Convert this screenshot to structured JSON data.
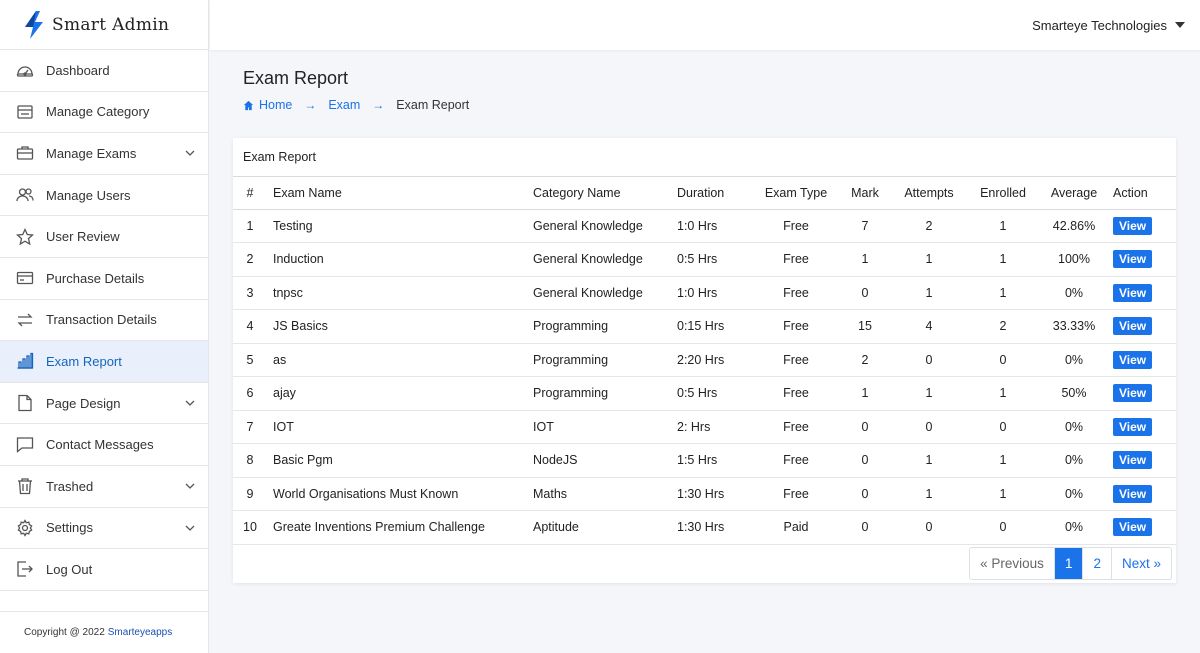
{
  "brand": {
    "name": "Smart Admin"
  },
  "topbar": {
    "org_name": "Smarteye Technologies"
  },
  "sidebar": {
    "items": [
      {
        "label": "Dashboard",
        "icon": "dashboard-icon"
      },
      {
        "label": "Manage Category",
        "icon": "category-icon"
      },
      {
        "label": "Manage Exams",
        "icon": "exams-icon",
        "expandable": true
      },
      {
        "label": "Manage Users",
        "icon": "users-icon"
      },
      {
        "label": "User Review",
        "icon": "star-icon"
      },
      {
        "label": "Purchase Details",
        "icon": "card-icon"
      },
      {
        "label": "Transaction Details",
        "icon": "transfer-icon"
      },
      {
        "label": "Exam Report",
        "icon": "bar-chart-icon",
        "active": true
      },
      {
        "label": "Page Design",
        "icon": "page-icon",
        "expandable": true
      },
      {
        "label": "Contact Messages",
        "icon": "message-icon"
      },
      {
        "label": "Trashed",
        "icon": "trash-icon",
        "expandable": true
      },
      {
        "label": "Settings",
        "icon": "gear-icon",
        "expandable": true
      },
      {
        "label": "Log Out",
        "icon": "logout-icon"
      }
    ],
    "footer": {
      "text": "Copyright @ 2022",
      "link": "Smarteyeapps"
    }
  },
  "page": {
    "title": "Exam Report",
    "breadcrumb": {
      "home": "Home",
      "exam": "Exam",
      "current": "Exam Report"
    }
  },
  "report": {
    "card_title": "Exam Report",
    "columns": [
      "#",
      "Exam Name",
      "Category Name",
      "Duration",
      "Exam Type",
      "Mark",
      "Attempts",
      "Enrolled",
      "Average",
      "Action"
    ],
    "rows": [
      {
        "num": "1",
        "name": "Testing",
        "category": "General Knowledge",
        "duration": "1:0 Hrs",
        "type": "Free",
        "mark": "7",
        "attempts": "2",
        "enrolled": "1",
        "average": "42.86%",
        "action": "View"
      },
      {
        "num": "2",
        "name": "Induction",
        "category": "General Knowledge",
        "duration": "0:5 Hrs",
        "type": "Free",
        "mark": "1",
        "attempts": "1",
        "enrolled": "1",
        "average": "100%",
        "action": "View"
      },
      {
        "num": "3",
        "name": "tnpsc",
        "category": "General Knowledge",
        "duration": "1:0 Hrs",
        "type": "Free",
        "mark": "0",
        "attempts": "1",
        "enrolled": "1",
        "average": "0%",
        "action": "View"
      },
      {
        "num": "4",
        "name": "JS Basics",
        "category": "Programming",
        "duration": "0:15 Hrs",
        "type": "Free",
        "mark": "15",
        "attempts": "4",
        "enrolled": "2",
        "average": "33.33%",
        "action": "View"
      },
      {
        "num": "5",
        "name": "as",
        "category": "Programming",
        "duration": "2:20 Hrs",
        "type": "Free",
        "mark": "2",
        "attempts": "0",
        "enrolled": "0",
        "average": "0%",
        "action": "View"
      },
      {
        "num": "6",
        "name": "ajay",
        "category": "Programming",
        "duration": "0:5 Hrs",
        "type": "Free",
        "mark": "1",
        "attempts": "1",
        "enrolled": "1",
        "average": "50%",
        "action": "View"
      },
      {
        "num": "7",
        "name": "IOT",
        "category": "IOT",
        "duration": "2: Hrs",
        "type": "Free",
        "mark": "0",
        "attempts": "0",
        "enrolled": "0",
        "average": "0%",
        "action": "View"
      },
      {
        "num": "8",
        "name": "Basic Pgm",
        "category": "NodeJS",
        "duration": "1:5 Hrs",
        "type": "Free",
        "mark": "0",
        "attempts": "1",
        "enrolled": "1",
        "average": "0%",
        "action": "View"
      },
      {
        "num": "9",
        "name": "World Organisations Must Known",
        "category": "Maths",
        "duration": "1:30 Hrs",
        "type": "Free",
        "mark": "0",
        "attempts": "1",
        "enrolled": "1",
        "average": "0%",
        "action": "View"
      },
      {
        "num": "10",
        "name": "Greate Inventions Premium Challenge",
        "category": "Aptitude",
        "duration": "1:30 Hrs",
        "type": "Paid",
        "mark": "0",
        "attempts": "0",
        "enrolled": "0",
        "average": "0%",
        "action": "View"
      }
    ]
  },
  "pagination": {
    "previous": "« Previous",
    "pages": [
      "1",
      "2"
    ],
    "current": "1",
    "next": "Next »"
  },
  "colors": {
    "accent": "#1a73e8",
    "active_bg": "#eaf0fb",
    "logo": "#1a73e8"
  }
}
